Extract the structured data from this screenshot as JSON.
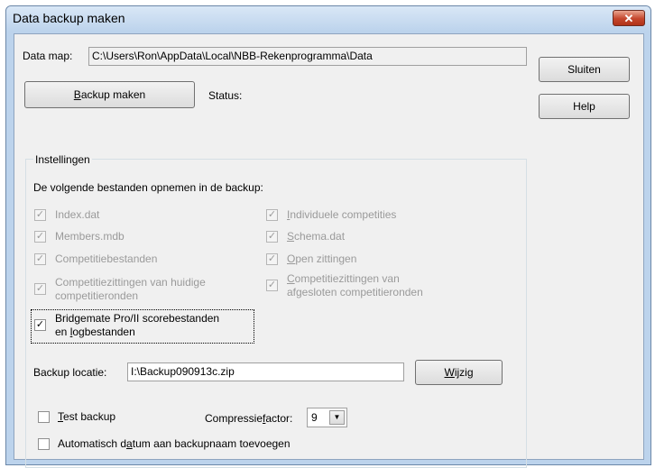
{
  "window": {
    "title": "Data backup maken",
    "close_glyph": "✕"
  },
  "data_map": {
    "label": "Data map:",
    "value": "C:\\Users\\Ron\\AppData\\Local\\NBB-Rekenprogramma\\Data"
  },
  "buttons": {
    "backup_first": "B",
    "backup_rest": "ackup maken",
    "close": "Sluiten",
    "help": "Help",
    "change_first": "W",
    "change_rest": "ijzig"
  },
  "status": {
    "label": "Status:"
  },
  "settings": {
    "group_label": "Instellingen",
    "intro": "De volgende bestanden opnemen in de backup:",
    "check_glyph": "✓",
    "items": {
      "index": {
        "label": "Index.dat",
        "checked": true,
        "enabled": false
      },
      "members": {
        "label": "Members.mdb",
        "checked": true,
        "enabled": false
      },
      "competition_files": {
        "label": "Competitiebestanden",
        "checked": true,
        "enabled": false
      },
      "sessions_current_1": {
        "label": "Competitiezittingen van huidige"
      },
      "sessions_current_2": {
        "label": "competitieronden"
      },
      "bridgemate_1": {
        "label": "Bridgemate Pro/II scorebestanden",
        "checked": true,
        "enabled": true
      },
      "bridgemate_2a": {
        "label": "en "
      },
      "bridgemate_2b": {
        "label": "l"
      },
      "bridgemate_2c": {
        "label": "ogbestanden"
      },
      "individual_a": {
        "label": "I"
      },
      "individual_b": {
        "label": "ndividuele competities"
      },
      "schema_a": {
        "label": "S"
      },
      "schema_b": {
        "label": "chema.dat"
      },
      "open_a": {
        "label": "O"
      },
      "open_b": {
        "label": "pen zittingen"
      },
      "sessions_closed_1a": {
        "label": "C"
      },
      "sessions_closed_1b": {
        "label": "ompetitiezittingen van"
      },
      "sessions_closed_2": {
        "label": "afgesloten competitieronden"
      }
    }
  },
  "backup_location": {
    "label": "Backup locatie:",
    "value": "I:\\Backup090913c.zip"
  },
  "options": {
    "test_first": "T",
    "test_rest": "est backup",
    "test_checked": false,
    "compression_label_a": "Compressie",
    "compression_label_b": "f",
    "compression_label_c": "actor:",
    "compression_value": "9",
    "auto_date_a": "Automatisch d",
    "auto_date_b": "a",
    "auto_date_c": "tum aan backupnaam toevoegen",
    "auto_date_checked": false
  }
}
